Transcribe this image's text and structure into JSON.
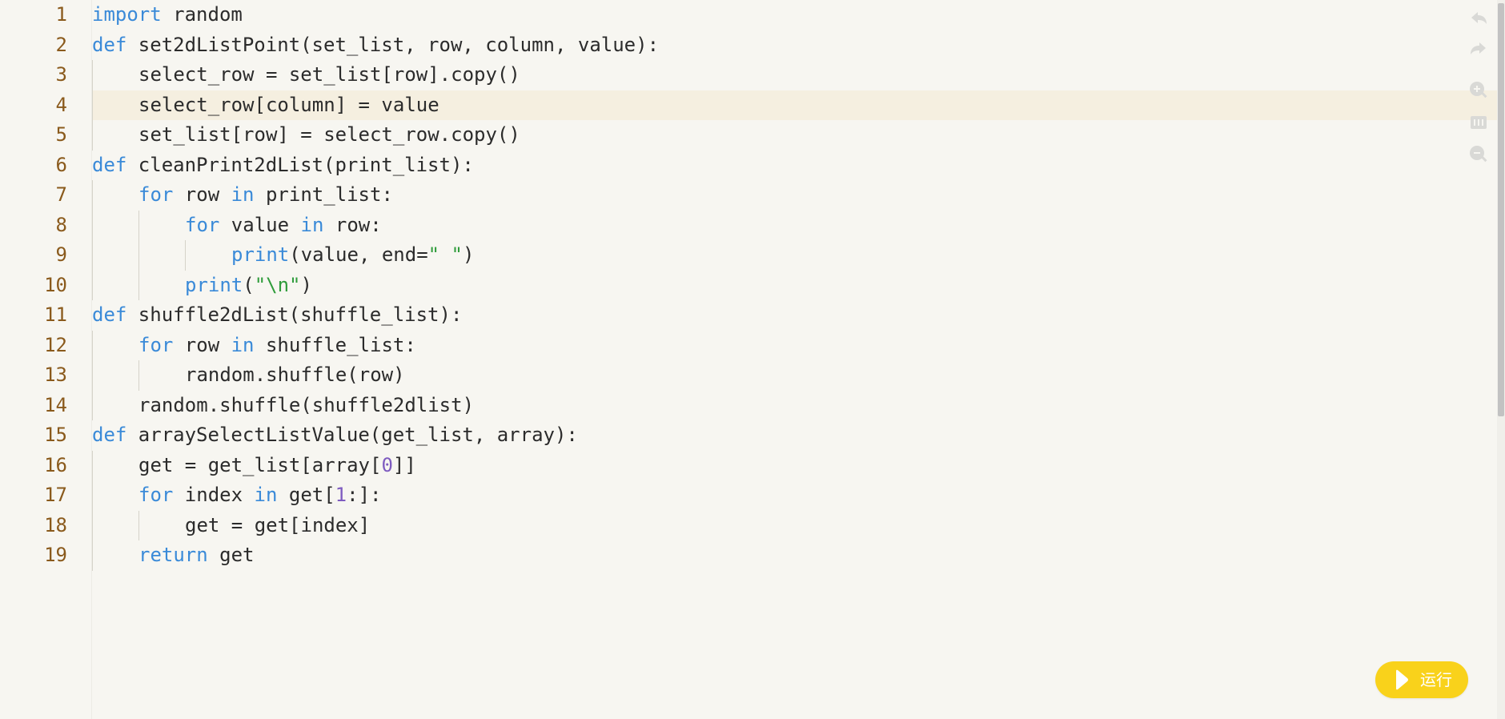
{
  "editor": {
    "active_line": 4,
    "lines": [
      {
        "number": "1",
        "indent": 0,
        "tokens": [
          {
            "t": "kw",
            "v": "import"
          },
          {
            "t": "plain",
            "v": " random"
          }
        ]
      },
      {
        "number": "2",
        "indent": 0,
        "tokens": [
          {
            "t": "kw",
            "v": "def"
          },
          {
            "t": "plain",
            "v": " set2dListPoint(set_list, row, column, value):"
          }
        ]
      },
      {
        "number": "3",
        "indent": 1,
        "tokens": [
          {
            "t": "plain",
            "v": "select_row = set_list[row].copy()"
          }
        ]
      },
      {
        "number": "4",
        "indent": 1,
        "tokens": [
          {
            "t": "plain",
            "v": "select_row[column] = value"
          }
        ]
      },
      {
        "number": "5",
        "indent": 1,
        "tokens": [
          {
            "t": "plain",
            "v": "set_list[row] = select_row.copy()"
          }
        ]
      },
      {
        "number": "6",
        "indent": 0,
        "tokens": [
          {
            "t": "kw",
            "v": "def"
          },
          {
            "t": "plain",
            "v": " cleanPrint2dList(print_list):"
          }
        ]
      },
      {
        "number": "7",
        "indent": 1,
        "tokens": [
          {
            "t": "kw",
            "v": "for"
          },
          {
            "t": "plain",
            "v": " row "
          },
          {
            "t": "kw",
            "v": "in"
          },
          {
            "t": "plain",
            "v": " print_list:"
          }
        ]
      },
      {
        "number": "8",
        "indent": 2,
        "tokens": [
          {
            "t": "kw",
            "v": "for"
          },
          {
            "t": "plain",
            "v": " value "
          },
          {
            "t": "kw",
            "v": "in"
          },
          {
            "t": "plain",
            "v": " row:"
          }
        ]
      },
      {
        "number": "9",
        "indent": 3,
        "tokens": [
          {
            "t": "kw",
            "v": "print"
          },
          {
            "t": "plain",
            "v": "(value, end="
          },
          {
            "t": "str",
            "v": "\" \""
          },
          {
            "t": "plain",
            "v": ")"
          }
        ]
      },
      {
        "number": "10",
        "indent": 2,
        "tokens": [
          {
            "t": "kw",
            "v": "print"
          },
          {
            "t": "plain",
            "v": "("
          },
          {
            "t": "str",
            "v": "\"\\n\""
          },
          {
            "t": "plain",
            "v": ")"
          }
        ]
      },
      {
        "number": "11",
        "indent": 0,
        "tokens": [
          {
            "t": "kw",
            "v": "def"
          },
          {
            "t": "plain",
            "v": " shuffle2dList(shuffle_list):"
          }
        ]
      },
      {
        "number": "12",
        "indent": 1,
        "tokens": [
          {
            "t": "kw",
            "v": "for"
          },
          {
            "t": "plain",
            "v": " row "
          },
          {
            "t": "kw",
            "v": "in"
          },
          {
            "t": "plain",
            "v": " shuffle_list:"
          }
        ]
      },
      {
        "number": "13",
        "indent": 2,
        "tokens": [
          {
            "t": "plain",
            "v": "random.shuffle(row)"
          }
        ]
      },
      {
        "number": "14",
        "indent": 1,
        "tokens": [
          {
            "t": "plain",
            "v": "random.shuffle(shuffle2dlist)"
          }
        ]
      },
      {
        "number": "15",
        "indent": 0,
        "tokens": [
          {
            "t": "kw",
            "v": "def"
          },
          {
            "t": "plain",
            "v": " arraySelectListValue(get_list, array):"
          }
        ]
      },
      {
        "number": "16",
        "indent": 1,
        "tokens": [
          {
            "t": "plain",
            "v": "get = get_list[array["
          },
          {
            "t": "num",
            "v": "0"
          },
          {
            "t": "plain",
            "v": "]]"
          }
        ]
      },
      {
        "number": "17",
        "indent": 1,
        "tokens": [
          {
            "t": "kw",
            "v": "for"
          },
          {
            "t": "plain",
            "v": " index "
          },
          {
            "t": "kw",
            "v": "in"
          },
          {
            "t": "plain",
            "v": " get["
          },
          {
            "t": "num",
            "v": "1"
          },
          {
            "t": "plain",
            "v": ":]:"
          }
        ]
      },
      {
        "number": "18",
        "indent": 2,
        "tokens": [
          {
            "t": "plain",
            "v": "get = get[index]"
          }
        ]
      },
      {
        "number": "19",
        "indent": 1,
        "tokens": [
          {
            "t": "kw",
            "v": "return"
          },
          {
            "t": "plain",
            "v": " get"
          }
        ]
      }
    ]
  },
  "toolbar": {
    "icons": [
      "undo-icon",
      "redo-icon",
      "zoom-in-icon",
      "fit-icon",
      "zoom-out-icon"
    ]
  },
  "run_button": {
    "label": "运行"
  },
  "colors": {
    "background": "#f7f6f1",
    "active_line": "#f5efe0",
    "line_number": "#8a5a1c",
    "keyword": "#3a8ad8",
    "string": "#2f9c3b",
    "number": "#7e5bc0",
    "run_button": "#f9d21b"
  }
}
